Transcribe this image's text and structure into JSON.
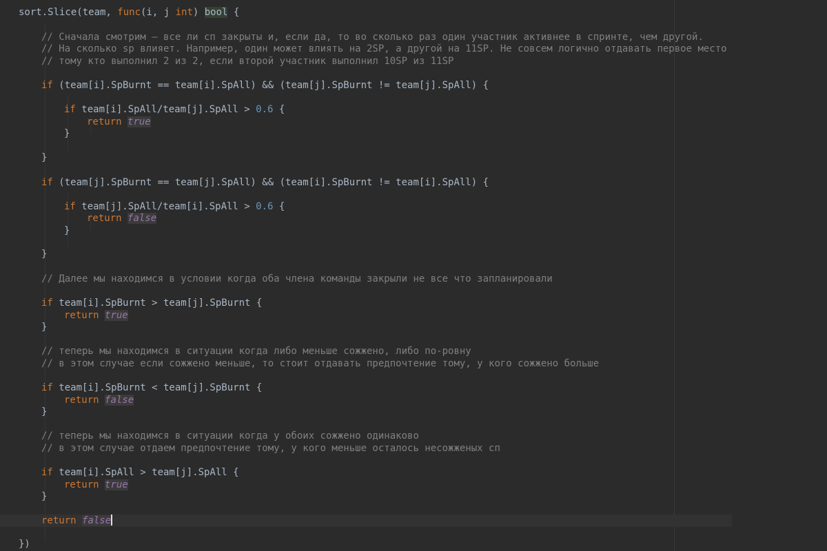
{
  "editor": {
    "lines": {
      "l0": {
        "a": "sort.Slice(team, ",
        "b": "func",
        "c": "(i, j ",
        "d": "int",
        "e": ") ",
        "f": "bool",
        "g": " {"
      },
      "c1": "// Сначала смотрим – все ли сп закрыты и, если да, то во сколько раз один участник активнее в спринте, чем другой.",
      "c2": "// На сколько sp влияет. Например, один может влиять на 2SP, а другой на 11SP. Не совсем логично отдавать первое место",
      "c3": "// тому кто выполнил 2 из 2, если второй участник выполнил 10SP из 11SP",
      "if1": {
        "kw": "if",
        "rest": " (team[i].SpBurnt == team[i].SpAll) && (team[j].SpBurnt != team[j].SpAll) {"
      },
      "if1a": {
        "kw": "if",
        "rest": " team[i].SpAll/team[j].SpAll > ",
        "num": "0.6",
        "end": " {"
      },
      "ret1": {
        "kw": "return",
        "val": "true"
      },
      "brace": "}",
      "if2": {
        "kw": "if",
        "rest": " (team[j].SpBurnt == team[j].SpAll) && (team[i].SpBurnt != team[i].SpAll) {"
      },
      "if2a": {
        "kw": "if",
        "rest": " team[j].SpAll/team[i].SpAll > ",
        "num": "0.6",
        "end": " {"
      },
      "ret2": {
        "kw": "return",
        "val": "false"
      },
      "c4": "// Далее мы находимся в условии когда оба члена команды закрыли не все что запланировали",
      "if3": {
        "kw": "if",
        "rest": " team[i].SpBurnt > team[j].SpBurnt {"
      },
      "ret3": {
        "kw": "return",
        "val": "true"
      },
      "c5": "// теперь мы находимся в ситуации когда либо меньше сожжено, либо по-ровну",
      "c6": "// в этом случае если сожжено меньше, то стоит отдавать предпочтение тому, у кого сожжено больше",
      "if4": {
        "kw": "if",
        "rest": " team[i].SpBurnt < team[j].SpBurnt {"
      },
      "ret4": {
        "kw": "return",
        "val": "false"
      },
      "c7": "// теперь мы находимся в ситуации когда у обоих сожжено одинаково",
      "c8": "// в этом случае отдаем предпочтение тому, у кого меньше осталось несожженых сп",
      "if5": {
        "kw": "if",
        "rest": " team[i].SpAll > team[j].SpAll {"
      },
      "ret5": {
        "kw": "return",
        "val": "true"
      },
      "ret6": {
        "kw": "return",
        "val": "false"
      },
      "end": "})"
    }
  },
  "colors": {
    "background": "#2b2b2b",
    "keyword": "#cc7832",
    "comment": "#808080",
    "number": "#6897bb",
    "literal": "#9876aa",
    "text": "#a9b7c6"
  }
}
